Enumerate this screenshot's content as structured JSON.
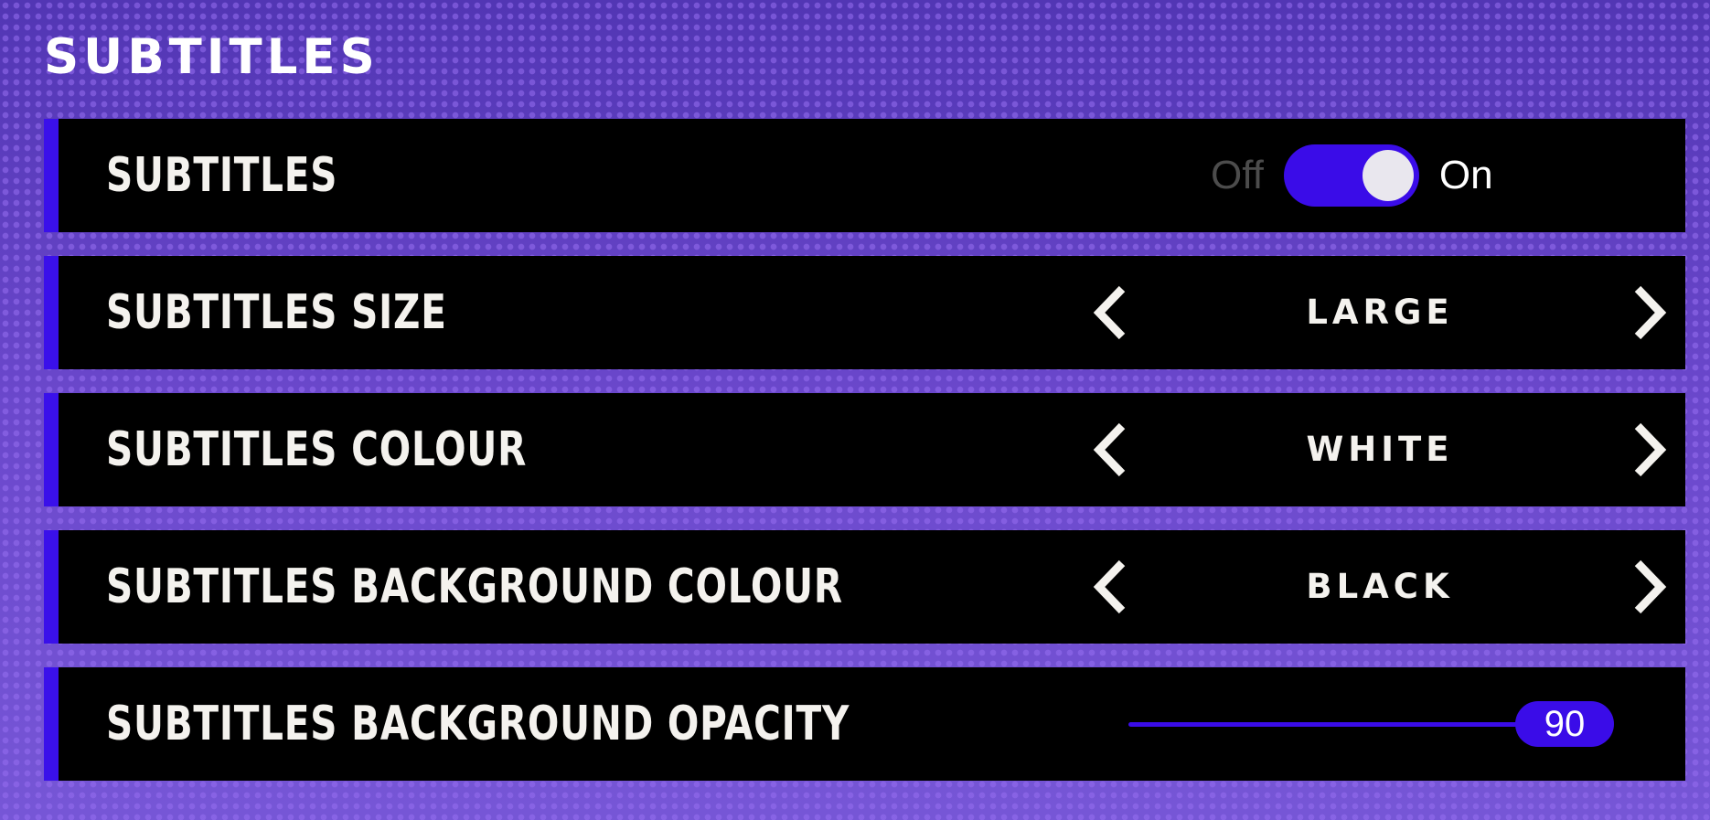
{
  "page": {
    "title": "SUBTITLES"
  },
  "colors": {
    "accent": "#3a0ce8",
    "row_background": "#000000",
    "text": "#f4f2ee",
    "off_text": "#4c4c4c",
    "background": "#6a46c8"
  },
  "icons": {
    "previous": "chevron-left-icon",
    "next": "chevron-right-icon"
  },
  "settings": {
    "subtitles": {
      "label": "SUBTITLES",
      "off_label": "Off",
      "on_label": "On",
      "enabled": true
    },
    "size": {
      "label": "SUBTITLES SIZE",
      "value": "LARGE"
    },
    "colour": {
      "label": "SUBTITLES COLOUR",
      "value": "WHITE"
    },
    "background_colour": {
      "label": "SUBTITLES BACKGROUND COLOUR",
      "value": "BLACK"
    },
    "background_opacity": {
      "label": "SUBTITLES BACKGROUND OPACITY",
      "value": "90",
      "min": 0,
      "max": 100
    }
  }
}
